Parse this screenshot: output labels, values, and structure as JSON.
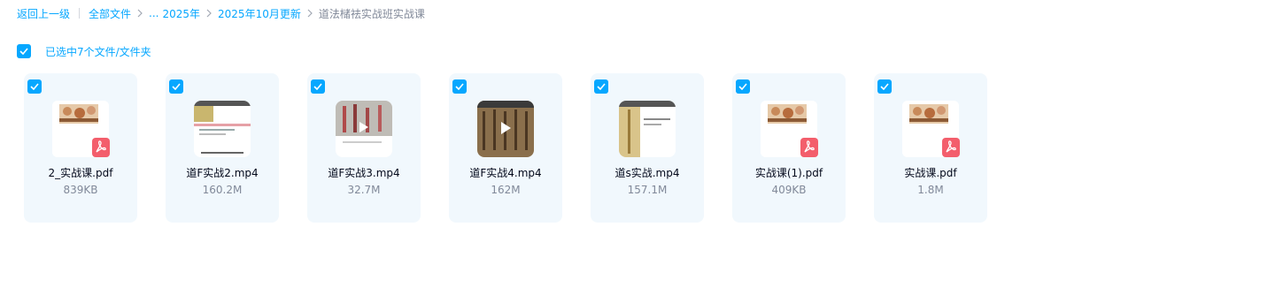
{
  "breadcrumb": {
    "back": "返回上一级",
    "all_files": "全部文件",
    "ellipsis": "...",
    "folder1": "2025年",
    "folder2": "2025年10月更新",
    "current": "道法槠祛实战班实战课"
  },
  "selection": {
    "label": "已选中7个文件/文件夹",
    "checked": true
  },
  "files": [
    {
      "name": "2_实战课.pdf",
      "size": "839KB",
      "type": "pdf"
    },
    {
      "name": "道F实战2.mp4",
      "size": "160.2M",
      "type": "video"
    },
    {
      "name": "道F实战3.mp4",
      "size": "32.7M",
      "type": "video"
    },
    {
      "name": "道F实战4.mp4",
      "size": "162M",
      "type": "video"
    },
    {
      "name": "道s实战.mp4",
      "size": "157.1M",
      "type": "video"
    },
    {
      "name": "实战课(1).pdf",
      "size": "409KB",
      "type": "pdf"
    },
    {
      "name": "实战课.pdf",
      "size": "1.8M",
      "type": "pdf"
    }
  ],
  "colors": {
    "accent": "#06a7ff",
    "card_bg": "#f1f8fd",
    "pdf_red": "#f35e6c",
    "muted_text": "#818999"
  }
}
